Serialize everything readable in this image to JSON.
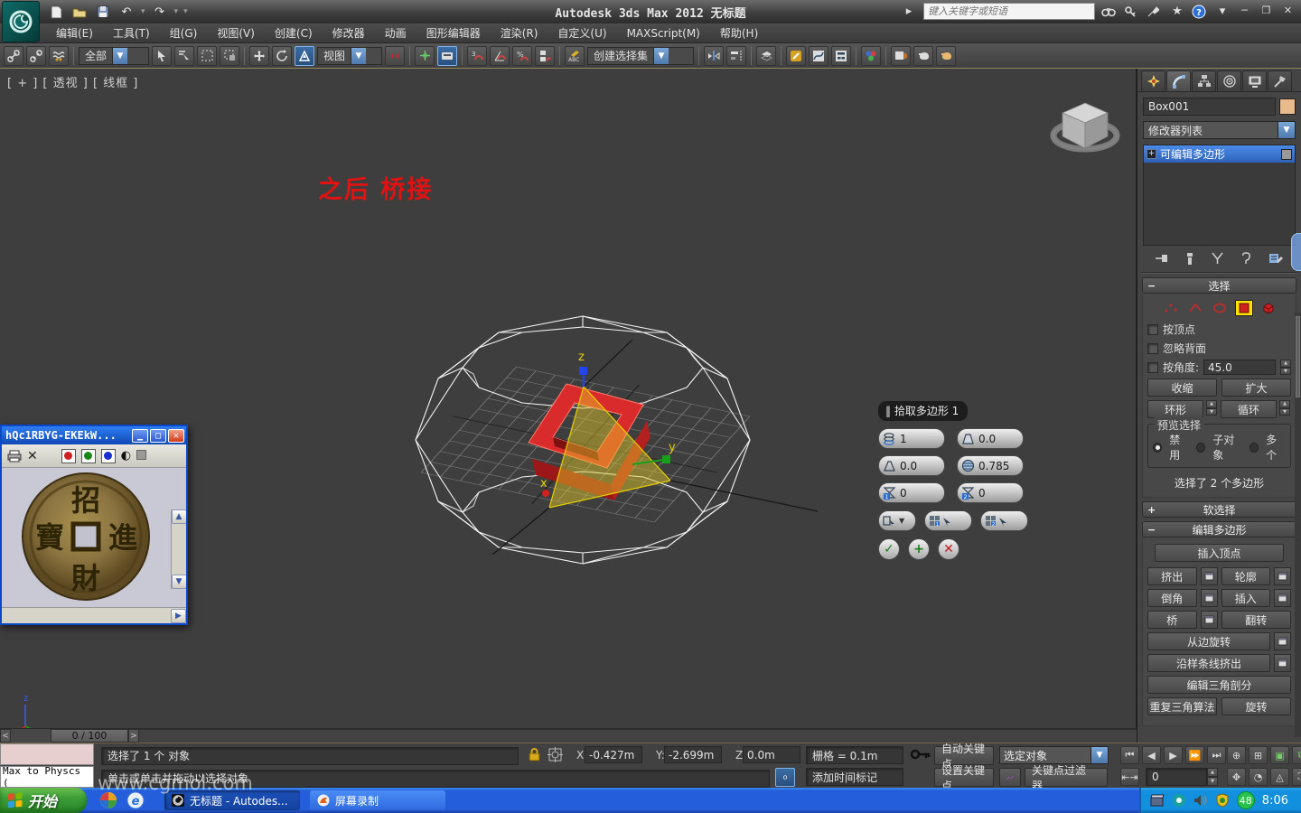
{
  "titlebar": {
    "title": "Autodesk 3ds Max  2012      无标题",
    "search_placeholder": "键入关键字或短语"
  },
  "menubar": {
    "items": [
      "编辑(E)",
      "工具(T)",
      "组(G)",
      "视图(V)",
      "创建(C)",
      "修改器",
      "动画",
      "图形编辑器",
      "渲染(R)",
      "自定义(U)",
      "MAXScript(M)",
      "帮助(H)"
    ]
  },
  "toolbar": {
    "filter_dropdown": "全部",
    "ref_coord_dropdown": "视图",
    "named_selection": "创建选择集"
  },
  "viewport": {
    "label": "[ + ] [ 透视 ] [ 线框 ]",
    "annotation": "之后 桥接",
    "watermark": "www.cgmol.com",
    "axis_x": "x",
    "axis_y": "y",
    "axis_z": "z"
  },
  "caddy": {
    "title": "拾取多边形 1",
    "prefix": "‖",
    "segments_value": "1",
    "taper_value": "0.0",
    "bias_value": "0.0",
    "smooth_value": "0.785",
    "twist1_value": "0",
    "twist2_value": "0",
    "twist1_badge": "1",
    "twist2_badge": "2",
    "target1_badge": "1",
    "target2_badge": "2",
    "ok": "✓",
    "apply": "+",
    "cancel": "✕"
  },
  "coin_window": {
    "title": "hQc1RBYG-EKEkW...",
    "chars": {
      "top": "招",
      "right": "進",
      "bottom": "財",
      "left": "寶"
    }
  },
  "command_panel": {
    "object_name": "Box001",
    "modifier_list": "修改器列表",
    "stack_item": "可编辑多边形",
    "selection": {
      "title": "选择",
      "by_vertex": "按顶点",
      "ignore_backfacing": "忽略背面",
      "by_angle": "按角度:",
      "angle_value": "45.0",
      "shrink": "收缩",
      "grow": "扩大",
      "ring": "环形",
      "loop": "循环",
      "preview_group": "预览选择",
      "radio_disabled": "禁用",
      "radio_subobj": "子对象",
      "radio_multi": "多个",
      "status": "选择了 2 个多边形"
    },
    "soft_selection_title": "软选择",
    "edit_poly": {
      "title": "编辑多边形",
      "insert_vertex": "插入顶点",
      "extrude": "挤出",
      "outline": "轮廓",
      "bevel": "倒角",
      "inset": "插入",
      "bridge": "桥",
      "flip": "翻转",
      "hinge_from_edge": "从边旋转",
      "extrude_along_spline": "沿样条线挤出",
      "edit_triangulation": "编辑三角剖分",
      "retriangulate": "重复三角算法",
      "turn": "旋转"
    }
  },
  "trackbar": {
    "prev": "<",
    "display": "0 / 100",
    "next": ">"
  },
  "statusbar": {
    "listener_text": "Max to Physcs (",
    "status_line": "选择了 1 个 对象",
    "prompt_line": "单击或单击并拖动以选择对象",
    "x_label": "X:",
    "x_value": "-0.427m",
    "y_label": "Y:",
    "y_value": "-2.699m",
    "z_label": "Z:",
    "z_value": "0.0m",
    "grid_value": "栅格 = 0.1m",
    "add_time_tag": "添加时间标记",
    "auto_key": "自动关键点",
    "set_key": "设置关键点",
    "selection_filter": "选定对象",
    "key_filters": "关键点过滤器...",
    "frame_value": "0"
  },
  "taskbar": {
    "start": "开始",
    "task1": "无标题 - Autodes...",
    "task2": "屏幕录制",
    "tray_badge": "48",
    "time": "8:06"
  },
  "colors": {
    "accent_blue": "#2e62b8",
    "select_red": "#d42a2a",
    "highlight_yellow": "#ffe000",
    "xp_blue": "#245edb"
  }
}
